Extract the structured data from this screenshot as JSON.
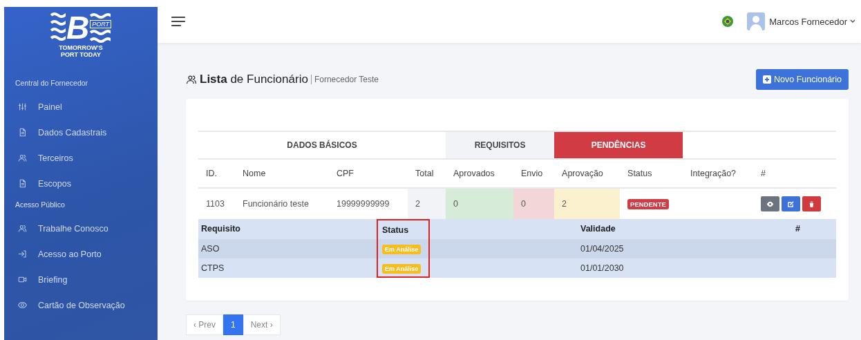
{
  "sidebar": {
    "logo": {
      "letter": "B",
      "badge": "PORT",
      "tagline_1": "TOMORROW'S",
      "tagline_2": "PORT TODAY"
    },
    "sections": [
      {
        "title": "Central do Fornecedor",
        "items": [
          {
            "label": "Painel"
          },
          {
            "label": "Dados Cadastrais"
          },
          {
            "label": "Terceiros"
          },
          {
            "label": "Escopos"
          }
        ]
      },
      {
        "title": "Acesso Público",
        "items": [
          {
            "label": "Trabalhe Conosco"
          },
          {
            "label": "Acesso ao Porto"
          },
          {
            "label": "Briefing"
          },
          {
            "label": "Cartão de Observação"
          }
        ]
      }
    ]
  },
  "topbar": {
    "user": "Marcos Fornecedor"
  },
  "page": {
    "title_bold": "Lista",
    "title_rest": "de Funcionário",
    "subtitle": "Fornecedor Teste",
    "new_button": "Novo Funcionário"
  },
  "table": {
    "groups": [
      {
        "label": "DADOS BÁSICOS",
        "kind": "plain"
      },
      {
        "label": "REQUISITOS",
        "kind": "muted"
      },
      {
        "label": "PENDÊNCIAS",
        "kind": "danger"
      }
    ],
    "columns": [
      "ID.",
      "Nome",
      "CPF",
      "Total",
      "Aprovados",
      "Envio",
      "Aprovação",
      "Status",
      "Integração?",
      "#"
    ],
    "rows": [
      {
        "cells": [
          "1103",
          "Funcionário teste",
          "19999999999",
          "2",
          "0",
          "0",
          "2"
        ],
        "status": "PENDENTE",
        "details": {
          "columns": [
            {
              "label": "Requisito",
              "highlight": false
            },
            {
              "label": "Status",
              "highlight": true
            },
            {
              "label": "Validade",
              "highlight": false
            },
            {
              "label": "#",
              "highlight": false
            }
          ],
          "rows": [
            {
              "requirement": "ASO",
              "status": "Em Análise",
              "validity": "01/04/2025"
            },
            {
              "requirement": "CTPS",
              "status": "Em Análise",
              "validity": "01/01/2030"
            }
          ]
        }
      }
    ]
  },
  "pagination": {
    "prev": "‹ Prev",
    "pages": [
      {
        "label": "1",
        "selected": true
      }
    ],
    "next": "Next ›"
  }
}
